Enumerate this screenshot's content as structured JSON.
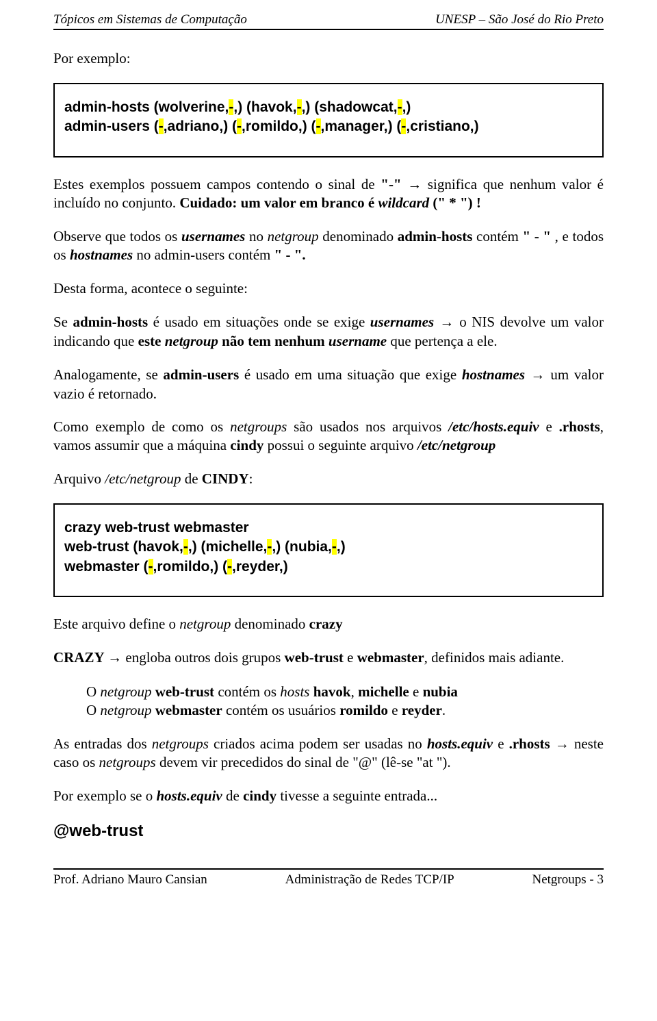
{
  "header": {
    "left": "Tópicos em Sistemas de Computação",
    "right": "UNESP – São José do Rio Preto"
  },
  "p_exemplo": "Por exemplo:",
  "box1": {
    "l1a": "admin-hosts  (wolverine,",
    "l1b": "-",
    "l1c": ",) (havok,",
    "l1d": "-",
    "l1e": ",) (shadowcat,",
    "l1f": "-",
    "l1g": ",)",
    "l2a": "admin-users  (",
    "l2b": "-",
    "l2c": ",adriano,) (",
    "l2d": "-",
    "l2e": ",romildo,) (",
    "l2f": "-",
    "l2g": ",manager,) (",
    "l2h": "-",
    "l2i": ",cristiano,)"
  },
  "p1a": "Estes exemplos possuem campos contendo o sinal de ",
  "p1b": "\"-\" ",
  "p1arrow": "→",
  "p1c": " significa que nenhum valor é incluído no conjunto. ",
  "p1d": "Cuidado: um valor em branco é ",
  "p1e": "wildcard",
  "p1f": " (\" * \") !",
  "p2a": "Observe que todos os ",
  "p2b": "usernames",
  "p2c": " no ",
  "p2d": "netgroup",
  "p2e": " denominado ",
  "p2f": "admin-hosts",
  "p2g": " contém ",
  "p2h": "\" - \"",
  "p2i": " , e todos os ",
  "p2j": "hostnames",
  "p2k": " no admin-users contém ",
  "p2l": "\" - \".",
  "p3": "Desta forma, acontece o seguinte:",
  "p4a": "Se ",
  "p4b": "admin-hosts",
  "p4c": " é usado em situações onde se exige ",
  "p4d": "usernames",
  "p4arrow": " → ",
  "p4e": "o NIS devolve um valor indicando que ",
  "p4f": "este ",
  "p4g": "netgroup",
  "p4h": " não tem nenhum ",
  "p4i": "username",
  "p4j": " que pertença a ele.",
  "p5a": "Analogamente, se ",
  "p5b": "admin-users",
  "p5c": " é usado em uma situação que exige ",
  "p5d": "hostnames",
  "p5arrow": " → ",
  "p5e": "um valor vazio é retornado.",
  "p6a": "Como exemplo de como os ",
  "p6b": "netgroups",
  "p6c": " são usados nos arquivos ",
  "p6d": "/etc/hosts.equiv",
  "p6e": " e ",
  "p6f": ".rhosts",
  "p6g": ", vamos assumir que a máquina ",
  "p6h": "cindy",
  "p6i": " possui o seguinte arquivo ",
  "p6j": "/etc/netgroup",
  "p7a": "Arquivo ",
  "p7b": "/etc/netgroup",
  "p7c": " de ",
  "p7d": "CINDY",
  "p7e": ":",
  "box2": {
    "l1": "crazy  web-trust  webmaster",
    "l2a": "web-trust  (havok,",
    "l2b": "-",
    "l2c": ",) (michelle,",
    "l2d": "-",
    "l2e": ",) (nubia,",
    "l2f": "-",
    "l2g": ",)",
    "l3a": "webmaster  (",
    "l3b": "-",
    "l3c": ",romildo,)  (",
    "l3d": "-",
    "l3e": ",reyder,)"
  },
  "p8a": "Este arquivo define o ",
  "p8b": "netgroup",
  "p8c": " denominado ",
  "p8d": "crazy",
  "p9a": "CRAZY ",
  "p9arrow": "→",
  "p9b": " engloba outros dois grupos ",
  "p9c": "web-trust",
  "p9d": " e ",
  "p9e": "webmaster",
  "p9f": ", definidos mais adiante.",
  "p10a": "O ",
  "p10b": "netgroup ",
  "p10c": "web-trust",
  "p10d": "  contém os ",
  "p10e": "hosts ",
  "p10f": "havok",
  "p10g": ", ",
  "p10h": "michelle",
  "p10i": " e ",
  "p10j": "nubia",
  "p11a": "O ",
  "p11b": "netgroup ",
  "p11c": "webmaster",
  "p11d": "  contém os usuários ",
  "p11e": "romildo",
  "p11f": " e ",
  "p11g": "reyder",
  "p11h": ".",
  "p12a": "As entradas dos ",
  "p12b": "netgroups",
  "p12c": " criados acima podem ser usadas no ",
  "p12d": "hosts.equiv",
  "p12e": " e ",
  "p12f": ".rhosts ",
  "p12arrow": "→",
  "p12g": " neste caso os ",
  "p12h": "netgroups",
  "p12i": " devem vir precedidos do sinal de \"@\" (lê-se \"at \").",
  "p13a": "Por exemplo se o ",
  "p13b": "hosts.equiv",
  "p13c": " de ",
  "p13d": "cindy",
  "p13e": " tivesse a seguinte entrada...",
  "wt": "@web-trust",
  "footer": {
    "left": "Prof. Adriano Mauro Cansian",
    "center": "Administração de Redes TCP/IP",
    "right": "Netgroups - 3"
  }
}
